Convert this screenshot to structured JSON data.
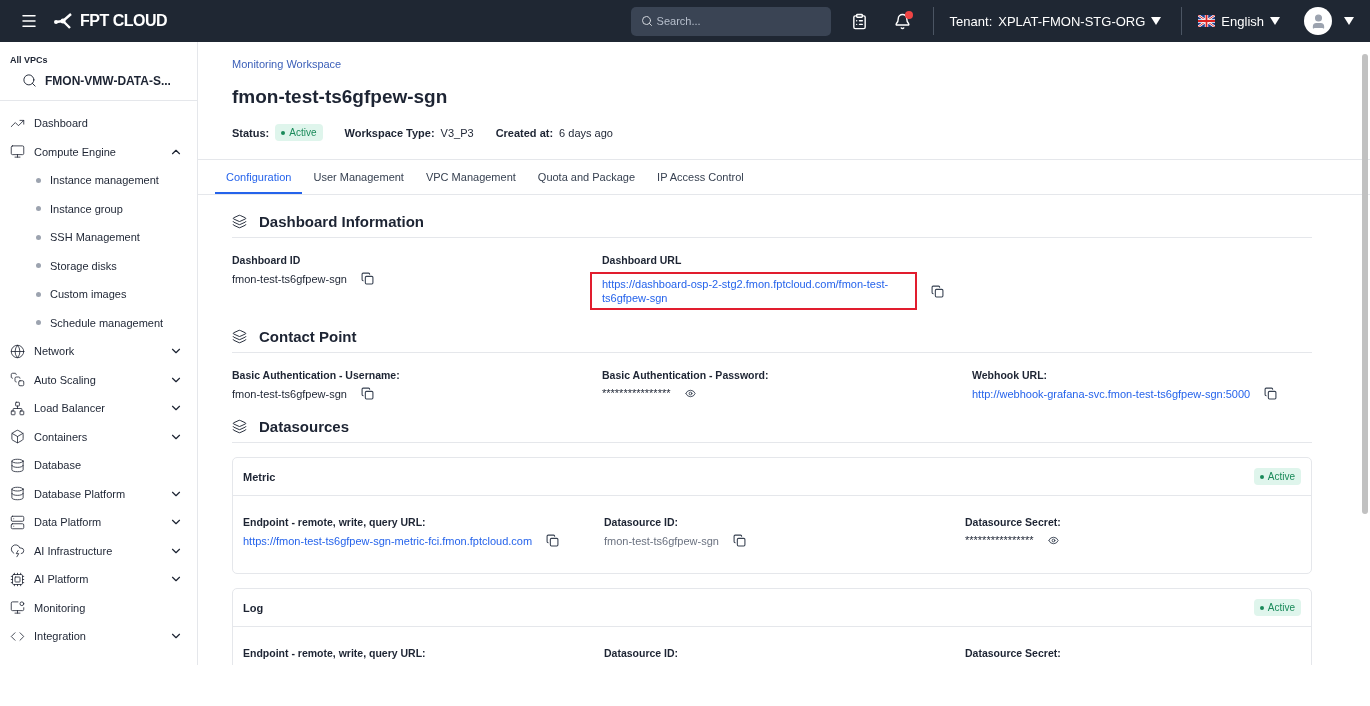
{
  "header": {
    "logo": "FPT CLOUD",
    "search": {
      "placeholder": "Search..."
    },
    "notifications": {
      "unread": true
    },
    "tenant": {
      "label": "Tenant:",
      "value": "XPLAT-FMON-STG-ORG"
    },
    "language": "English"
  },
  "sidebar": {
    "vpc_label": "All VPCs",
    "vpc": "FMON-VMW-DATA-S...",
    "items": [
      {
        "label": "Dashboard"
      },
      {
        "label": "Compute Engine",
        "expanded": true,
        "children": [
          {
            "label": "Instance management"
          },
          {
            "label": "Instance group"
          },
          {
            "label": "SSH Management"
          },
          {
            "label": "Storage disks"
          },
          {
            "label": "Custom images"
          },
          {
            "label": "Schedule management"
          }
        ]
      },
      {
        "label": "Network",
        "expanded": false
      },
      {
        "label": "Auto Scaling",
        "expanded": false
      },
      {
        "label": "Load Balancer",
        "expanded": false
      },
      {
        "label": "Containers",
        "expanded": false
      },
      {
        "label": "Database"
      },
      {
        "label": "Database Platform",
        "expanded": false
      },
      {
        "label": "Data Platform",
        "expanded": false
      },
      {
        "label": "AI Infrastructure",
        "expanded": false
      },
      {
        "label": "AI Platform",
        "expanded": false
      },
      {
        "label": "Monitoring"
      },
      {
        "label": "Integration",
        "expanded": false
      }
    ]
  },
  "breadcrumb": "Monitoring Workspace",
  "title": "fmon-test-ts6gfpew-sgn",
  "meta": [
    {
      "label": "Status:",
      "value": "Active",
      "kind": "badge"
    },
    {
      "label": "Workspace Type:",
      "value": "V3_P3",
      "kind": "text"
    },
    {
      "label": "Created at:",
      "value": "6 days ago",
      "kind": "text"
    }
  ],
  "tabs": [
    {
      "label": "Configuration",
      "selected": true
    },
    {
      "label": "User Management",
      "selected": false
    },
    {
      "label": "VPC Management",
      "selected": false
    },
    {
      "label": "Quota and Package",
      "selected": false
    },
    {
      "label": "IP Access Control",
      "selected": false
    }
  ],
  "sections": [
    {
      "title": "Dashboard Information",
      "fields": [
        {
          "label": "Dashboard ID",
          "value": "fmon-test-ts6gfpew-sgn",
          "kind": "text",
          "highlighted": false
        },
        {
          "label": "Dashboard URL",
          "value": "https://dashboard-osp-2-stg2.fmon.fptcloud.com/fmon-test-ts6gfpew-sgn",
          "kind": "link",
          "highlighted": true
        }
      ]
    },
    {
      "title": "Contact Point",
      "fields": [
        {
          "label": "Basic Authentication - Username:",
          "value": "fmon-test-ts6gfpew-sgn",
          "kind": "text",
          "highlighted": false
        },
        {
          "label": "Basic Authentication - Password:",
          "value": "****************",
          "kind": "secret",
          "highlighted": false
        },
        {
          "label": "Webhook URL:",
          "value": "http://webhook-grafana-svc.fmon-test-ts6gfpew-sgn:5000",
          "kind": "link",
          "highlighted": false
        }
      ]
    },
    {
      "title": "Datasources",
      "cards": [
        {
          "title": "Metric",
          "status": "Active",
          "fields": [
            {
              "label": "Endpoint - remote, write, query URL:",
              "value": "https://fmon-test-ts6gfpew-sgn-metric-fci.fmon.fptcloud.com",
              "kind": "link"
            },
            {
              "label": "Datasource ID:",
              "value": "fmon-test-ts6gfpew-sgn",
              "kind": "muted"
            },
            {
              "label": "Datasource Secret:",
              "value": "****************",
              "kind": "secret"
            }
          ]
        },
        {
          "title": "Log",
          "status": "Active",
          "fields": [
            {
              "label": "Endpoint - remote, write, query URL:"
            },
            {
              "label": "Datasource ID:"
            },
            {
              "label": "Datasource Secret:"
            }
          ]
        }
      ]
    }
  ]
}
